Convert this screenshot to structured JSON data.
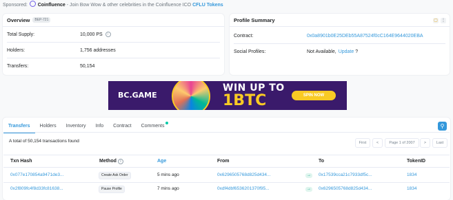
{
  "sponsored": {
    "prefix": "Sponsored:",
    "brand": "Coinfluence",
    "text": "- Join Bow Wow & other celebrities in the Coinfluence ICO",
    "link": "CFLU Tokens"
  },
  "overview": {
    "title": "Overview",
    "badge": "BEP-721",
    "total_supply_label": "Total Supply:",
    "total_supply_value": "10,000 PS",
    "holders_label": "Holders:",
    "holders_value": "1,756 addresses",
    "transfers_label": "Transfers:",
    "transfers_value": "50,154"
  },
  "profile": {
    "title": "Profile Summary",
    "contract_label": "Contract:",
    "contract_value": "0x0a8901b0E25DEb55A87524f0cC164E9644020EBA",
    "social_label": "Social Profiles:",
    "social_value": "Not Available,",
    "social_update": "Update",
    "social_q": "?"
  },
  "banner": {
    "logo": "BC.GAME",
    "headline": "WIN UP TO",
    "amount": "1BTC",
    "cta": "SPIN NOW"
  },
  "tabs": [
    "Transfers",
    "Holders",
    "Inventory",
    "Info",
    "Contract",
    "Comments"
  ],
  "summary": "A total of 50,154 transactions found",
  "pagination": {
    "first": "First",
    "prev": "<",
    "page": "Page 1 of 2007",
    "next": ">",
    "last": "Last"
  },
  "table": {
    "headers": [
      "Txn Hash",
      "Method",
      "Age",
      "From",
      "To",
      "TokenID"
    ],
    "rows": [
      {
        "hash": "0x077e170854a9471de3...",
        "method": "Create Ask Order",
        "age": "5 mins ago",
        "from": "0x6296505768d825d434...",
        "to": "0x17539cca21c7933df5c...",
        "token": "1834"
      },
      {
        "hash": "0x2f809fc4f8d33fc81638...",
        "method": "Pause Profile",
        "age": "7 mins ago",
        "from": "0xdf4dbf6536201370f95...",
        "to": "0x6296505768d825d434...",
        "token": "1834"
      }
    ]
  },
  "colors": {
    "accent": "#3498db",
    "banner_bg": "#3a1a6b",
    "banner_gold": "#f9ca24"
  }
}
